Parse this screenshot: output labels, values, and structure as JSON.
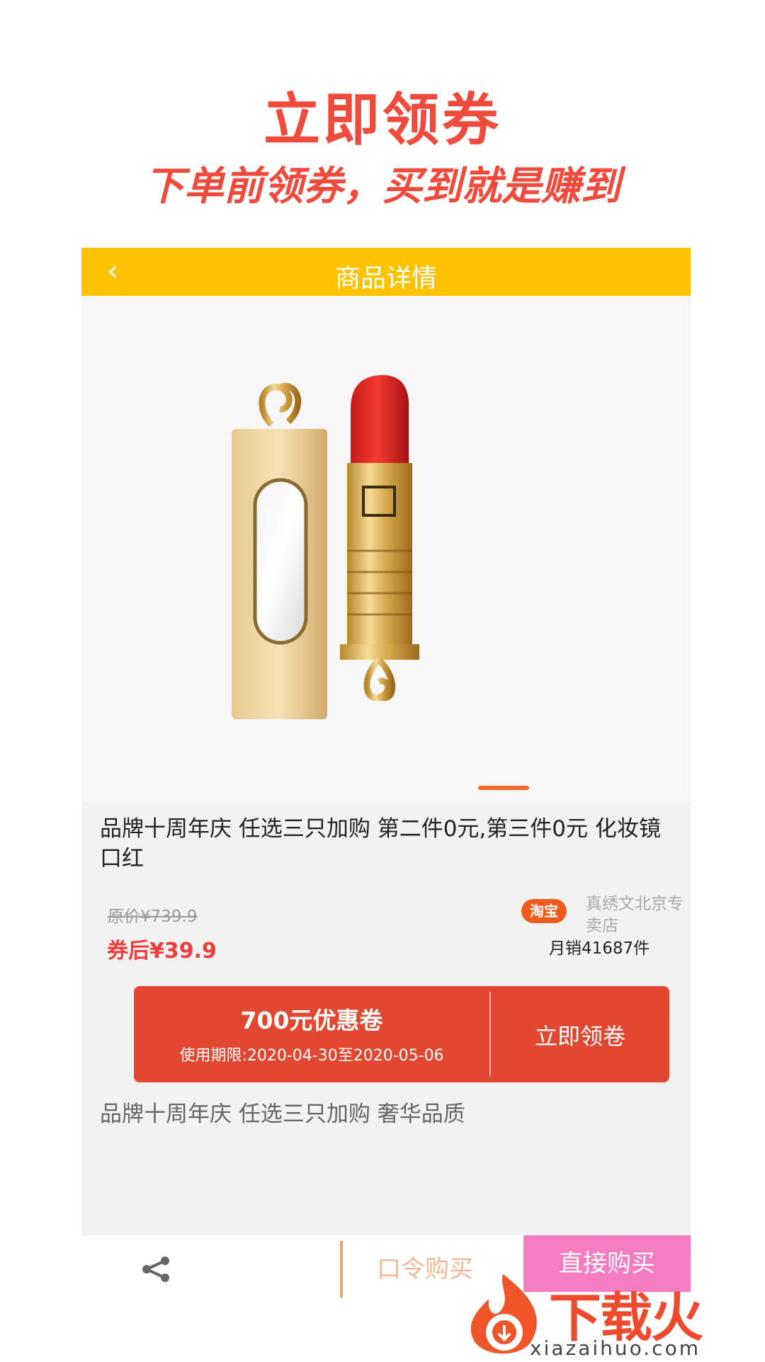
{
  "promo": {
    "title": "立即领券",
    "subtitle": "下单前领券，买到就是赚到"
  },
  "navbar": {
    "back_icon": "‹",
    "title": "商品详情"
  },
  "product": {
    "image": "lipstick-gold-case",
    "title": "品牌十周年庆 任选三只加购 第二件0元,第三件0元 化妆镜口红",
    "original_price": "原价¥739.9",
    "coupon_price": "券后¥39.9",
    "platform_badge": "淘宝",
    "store_name": "真绣文北京专卖店",
    "monthly_sales": "月销41687件",
    "description": "品牌十周年庆 任选三只加购 奢华品质"
  },
  "coupon": {
    "amount": "700元优惠卷",
    "validity": "使用期限:2020-04-30至2020-05-06",
    "claim_label": "立即领卷"
  },
  "bottom_bar": {
    "share_icon": "share-icon",
    "password_buy_label": "口令购买",
    "direct_buy_label": "直接购买"
  },
  "watermark": {
    "logo_text": "下载火",
    "url": "xiazaihuo.com"
  },
  "colors": {
    "accent_red": "#f04a3c",
    "navbar_yellow": "#fdc200",
    "coupon_red": "#e24731",
    "buy_pink": "#f564b6"
  }
}
